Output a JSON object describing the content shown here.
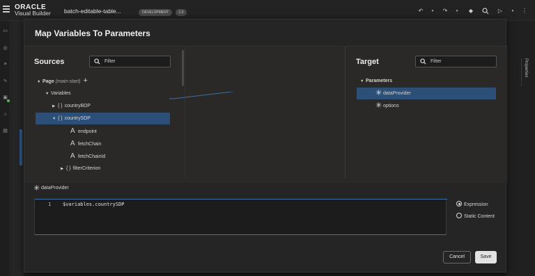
{
  "header": {
    "logo_line1": "ORACLE",
    "logo_line2": "Visual Builder",
    "app_title": "batch-editable-table...",
    "env_badge": "DEVELOPMENT",
    "version_badge": "1.0"
  },
  "right_panel": {
    "label": "Properties"
  },
  "dialog": {
    "title": "Map Variables To Parameters",
    "sources": {
      "title": "Sources",
      "filter_placeholder": "Filter",
      "tree": {
        "page_label": "Page",
        "page_suffix": "(main-start)",
        "variables_label": "Variables",
        "item1": "countryBDP",
        "item2": "countrySDP",
        "child1": "endpoint",
        "child2": "fetchChain",
        "child3": "fetchChainId",
        "item3": "filterCriterion"
      }
    },
    "target": {
      "title": "Target",
      "filter_placeholder": "Filter",
      "parameters_label": "Parameters",
      "param1": "dataProvider",
      "param2": "options"
    },
    "editor": {
      "field_label": "dataProvider",
      "line_number": "1",
      "code": "$variables.countrySDP"
    },
    "options": {
      "expression": "Expression",
      "static_content": "Static Content",
      "selected": "Expression"
    },
    "buttons": {
      "cancel": "Cancel",
      "save": "Save"
    }
  },
  "colors": {
    "selection": "#2c4f78",
    "accent": "#3f6fa3",
    "dialog_bg": "#252525",
    "status_green": "#5bb55b"
  }
}
